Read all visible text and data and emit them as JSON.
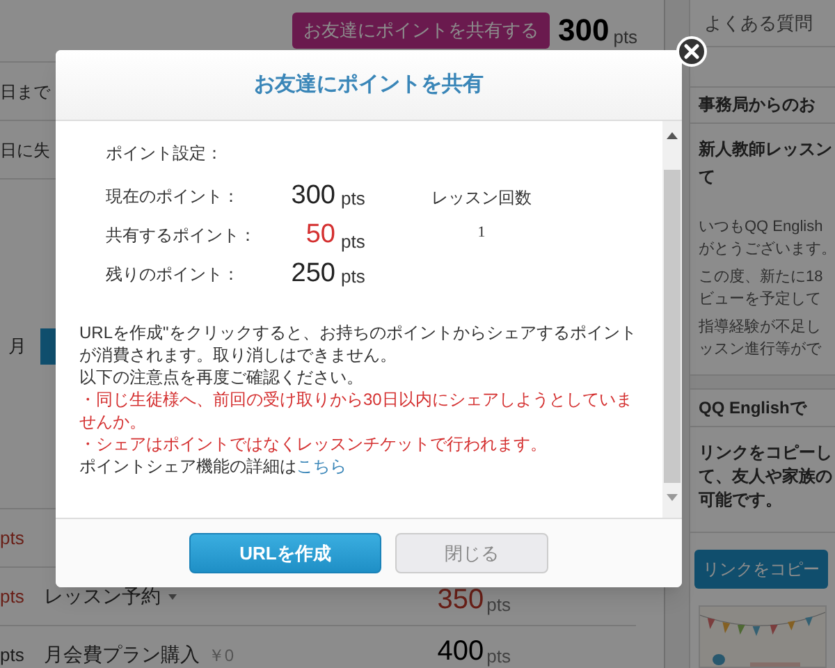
{
  "page": {
    "share_button": "お友達にポイントを共有する",
    "points": "300",
    "points_unit": "pts",
    "left_texts": [
      "日まで",
      "日に失"
    ],
    "month": "月",
    "rows": [
      {
        "pts_unit": "pts",
        "negative": true
      },
      {
        "pts_unit": "pts",
        "label": "レッスン予約",
        "dropdown": true,
        "value": "350",
        "unit": "pts",
        "negative": true
      },
      {
        "pts_unit": "pts",
        "label": "月会費プラン購入",
        "price": "￥0",
        "value": "400",
        "unit": "pts",
        "negative": false
      }
    ]
  },
  "sidebar": {
    "faq": "よくある質問",
    "notice_title": "事務局からのお",
    "news_title": [
      "新人教師レッスン",
      "て"
    ],
    "news_paragraphs": [
      [
        "いつもQQ English",
        "がとうございます。"
      ],
      [
        "この度、新たに18",
        "ビューを予定して"
      ],
      [
        "指導経験が不足し",
        "ッスン進行等がで"
      ]
    ],
    "share_title": "QQ Englishで",
    "share_text": [
      "リンクをコピーし",
      "て、友人や家族の",
      "可能です。"
    ],
    "copy_button": "リンクをコピー",
    "banner": {
      "kind": "picture"
    }
  },
  "modal": {
    "title": "お友達にポイントを共有",
    "settings_label": "ポイント設定：",
    "rows": [
      {
        "label": "現在のポイント：",
        "value": "300",
        "unit": "pts",
        "kind": "normal"
      },
      {
        "label": "共有するポイント：",
        "value": "50",
        "unit": "pts",
        "kind": "highlight"
      },
      {
        "label": "残りのポイント：",
        "value": "250",
        "unit": "pts",
        "kind": "normal"
      }
    ],
    "lessons_header": "レッスン回数",
    "lessons_value": "1",
    "paragraphs": [
      {
        "kind": "normal",
        "text": "URLを作成\"をクリックすると、お持ちのポイントからシェアするポイントが消費されます。取り消しはできません。"
      },
      {
        "kind": "normal",
        "text": "以下の注意点を再度ご確認ください。"
      },
      {
        "kind": "warning",
        "text": "・同じ生徒様へ、前回の受け取りから30日以内にシェアしようとしていませんか。"
      },
      {
        "kind": "warning",
        "text": "・シェアはポイントではなくレッスンチケットで行われます。"
      },
      {
        "kind": "link",
        "text": "ポイントシェア機能の詳細は",
        "link": "こちら"
      }
    ],
    "buttons": [
      {
        "label": "URLを作成",
        "kind": "primary"
      },
      {
        "label": "閉じる",
        "kind": "secondary"
      }
    ]
  }
}
